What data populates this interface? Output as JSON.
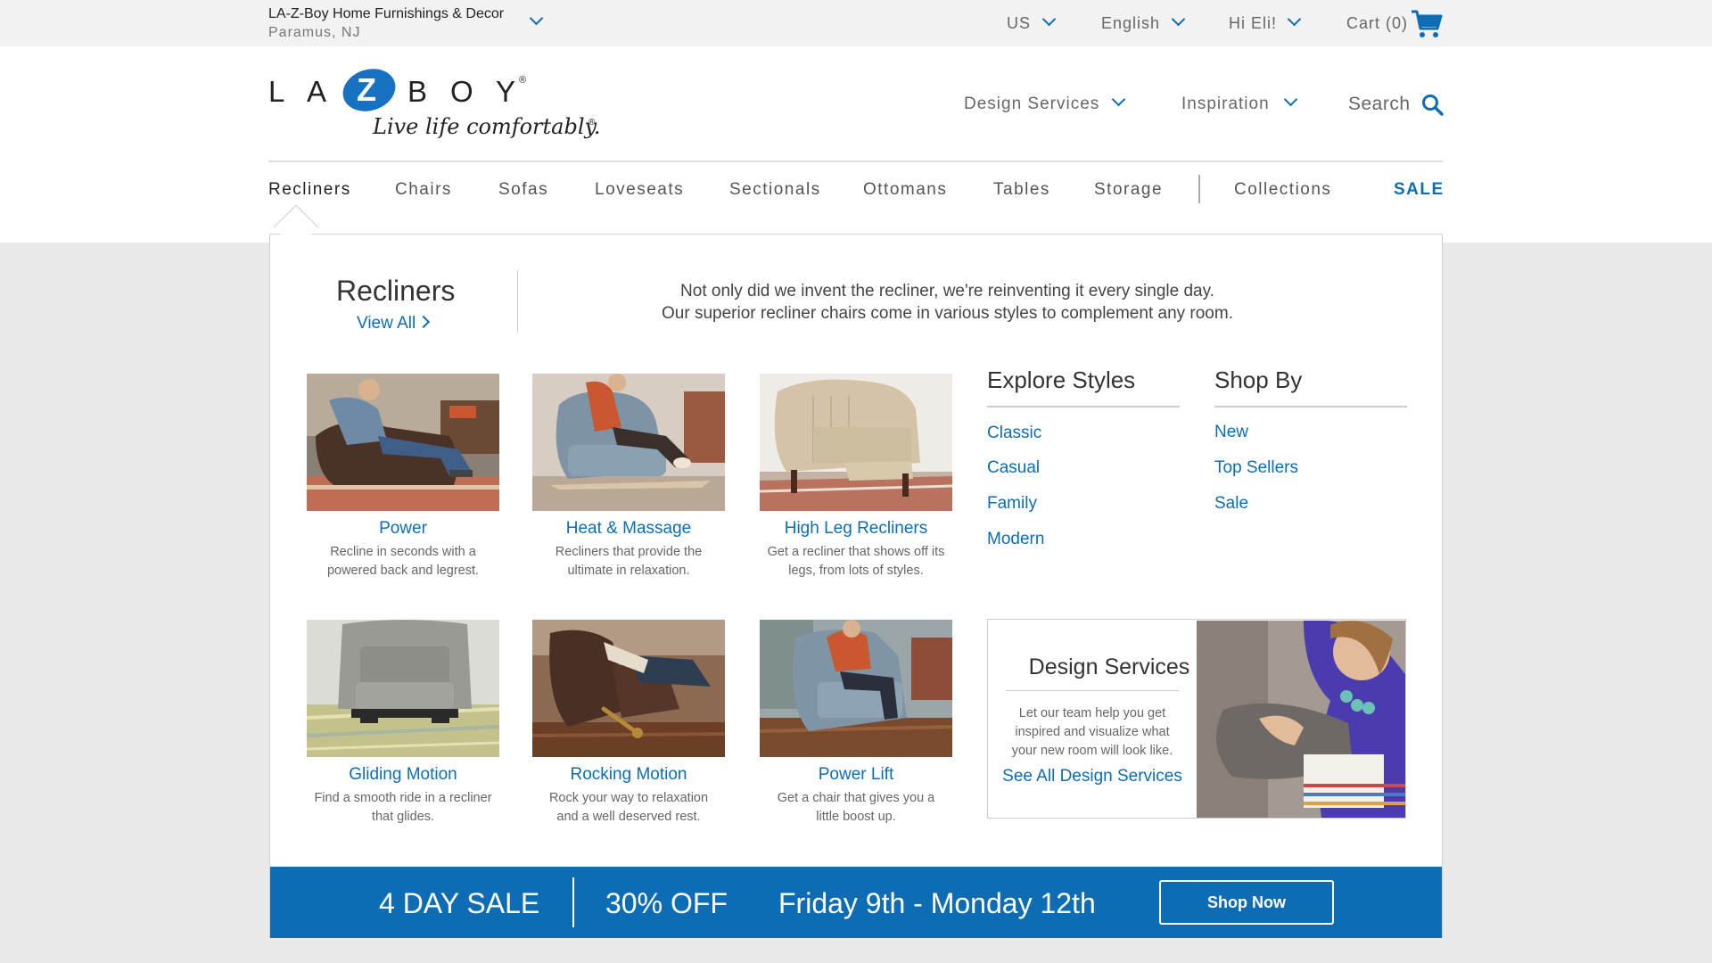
{
  "utility": {
    "store_name": "LA-Z-Boy Home Furnishings & Decor",
    "store_city": "Paramus, NJ",
    "country": "US",
    "language": "English",
    "greeting": "Hi Eli!",
    "cart": "Cart (0)"
  },
  "brand": {
    "letters": [
      "L",
      "A",
      "Z",
      "B",
      "O",
      "Y"
    ],
    "registered": "®",
    "tagline": "Live life comfortably.",
    "tagline_mark": "®"
  },
  "topnav": {
    "design_services": "Design Services",
    "inspiration": "Inspiration",
    "search": "Search"
  },
  "categories": [
    "Recliners",
    "Chairs",
    "Sofas",
    "Loveseats",
    "Sectionals",
    "Ottomans",
    "Tables",
    "Storage",
    "Collections",
    "SALE"
  ],
  "menu": {
    "title": "Recliners",
    "view_all": "View All",
    "intro_line1": "Not only did we invent the recliner, we're reinventing it every single day.",
    "intro_line2": "Our superior recliner chairs come in various styles to complement any room.",
    "products": [
      {
        "title": "Power",
        "desc": "Recline in seconds with a powered back and legrest."
      },
      {
        "title": "Heat & Massage",
        "desc": "Recliners that provide the ultimate in relaxation."
      },
      {
        "title": "High Leg Recliners",
        "desc": "Get a recliner that shows off its legs, from lots of styles."
      },
      {
        "title": "Gliding Motion",
        "desc": "Find a smooth ride in a recliner that glides."
      },
      {
        "title": "Rocking Motion",
        "desc": "Rock your way to relaxation and a well deserved rest."
      },
      {
        "title": "Power Lift",
        "desc": "Get a chair that gives you a little boost up."
      }
    ],
    "explore": {
      "heading": "Explore Styles",
      "links": [
        "Classic",
        "Casual",
        "Family",
        "Modern"
      ]
    },
    "shop_by": {
      "heading": "Shop By",
      "links": [
        "New",
        "Top Sellers",
        "Sale"
      ]
    },
    "design_services": {
      "title": "Design Services",
      "desc": "Let our team help you get inspired and visualize what your new room will look like.",
      "link": "See All Design Services"
    }
  },
  "banner": {
    "sale": "4 DAY SALE",
    "discount": "30% OFF",
    "dates": "Friday 9th - Monday 12th",
    "button": "Shop Now"
  },
  "colors": {
    "brand_blue": "#0e6cb4",
    "utility_bg": "#f2f2f2",
    "page_bg": "#e9e9e9"
  },
  "icons": [
    "chevron-down-icon",
    "cart-icon",
    "search-icon",
    "chevron-right-icon"
  ]
}
